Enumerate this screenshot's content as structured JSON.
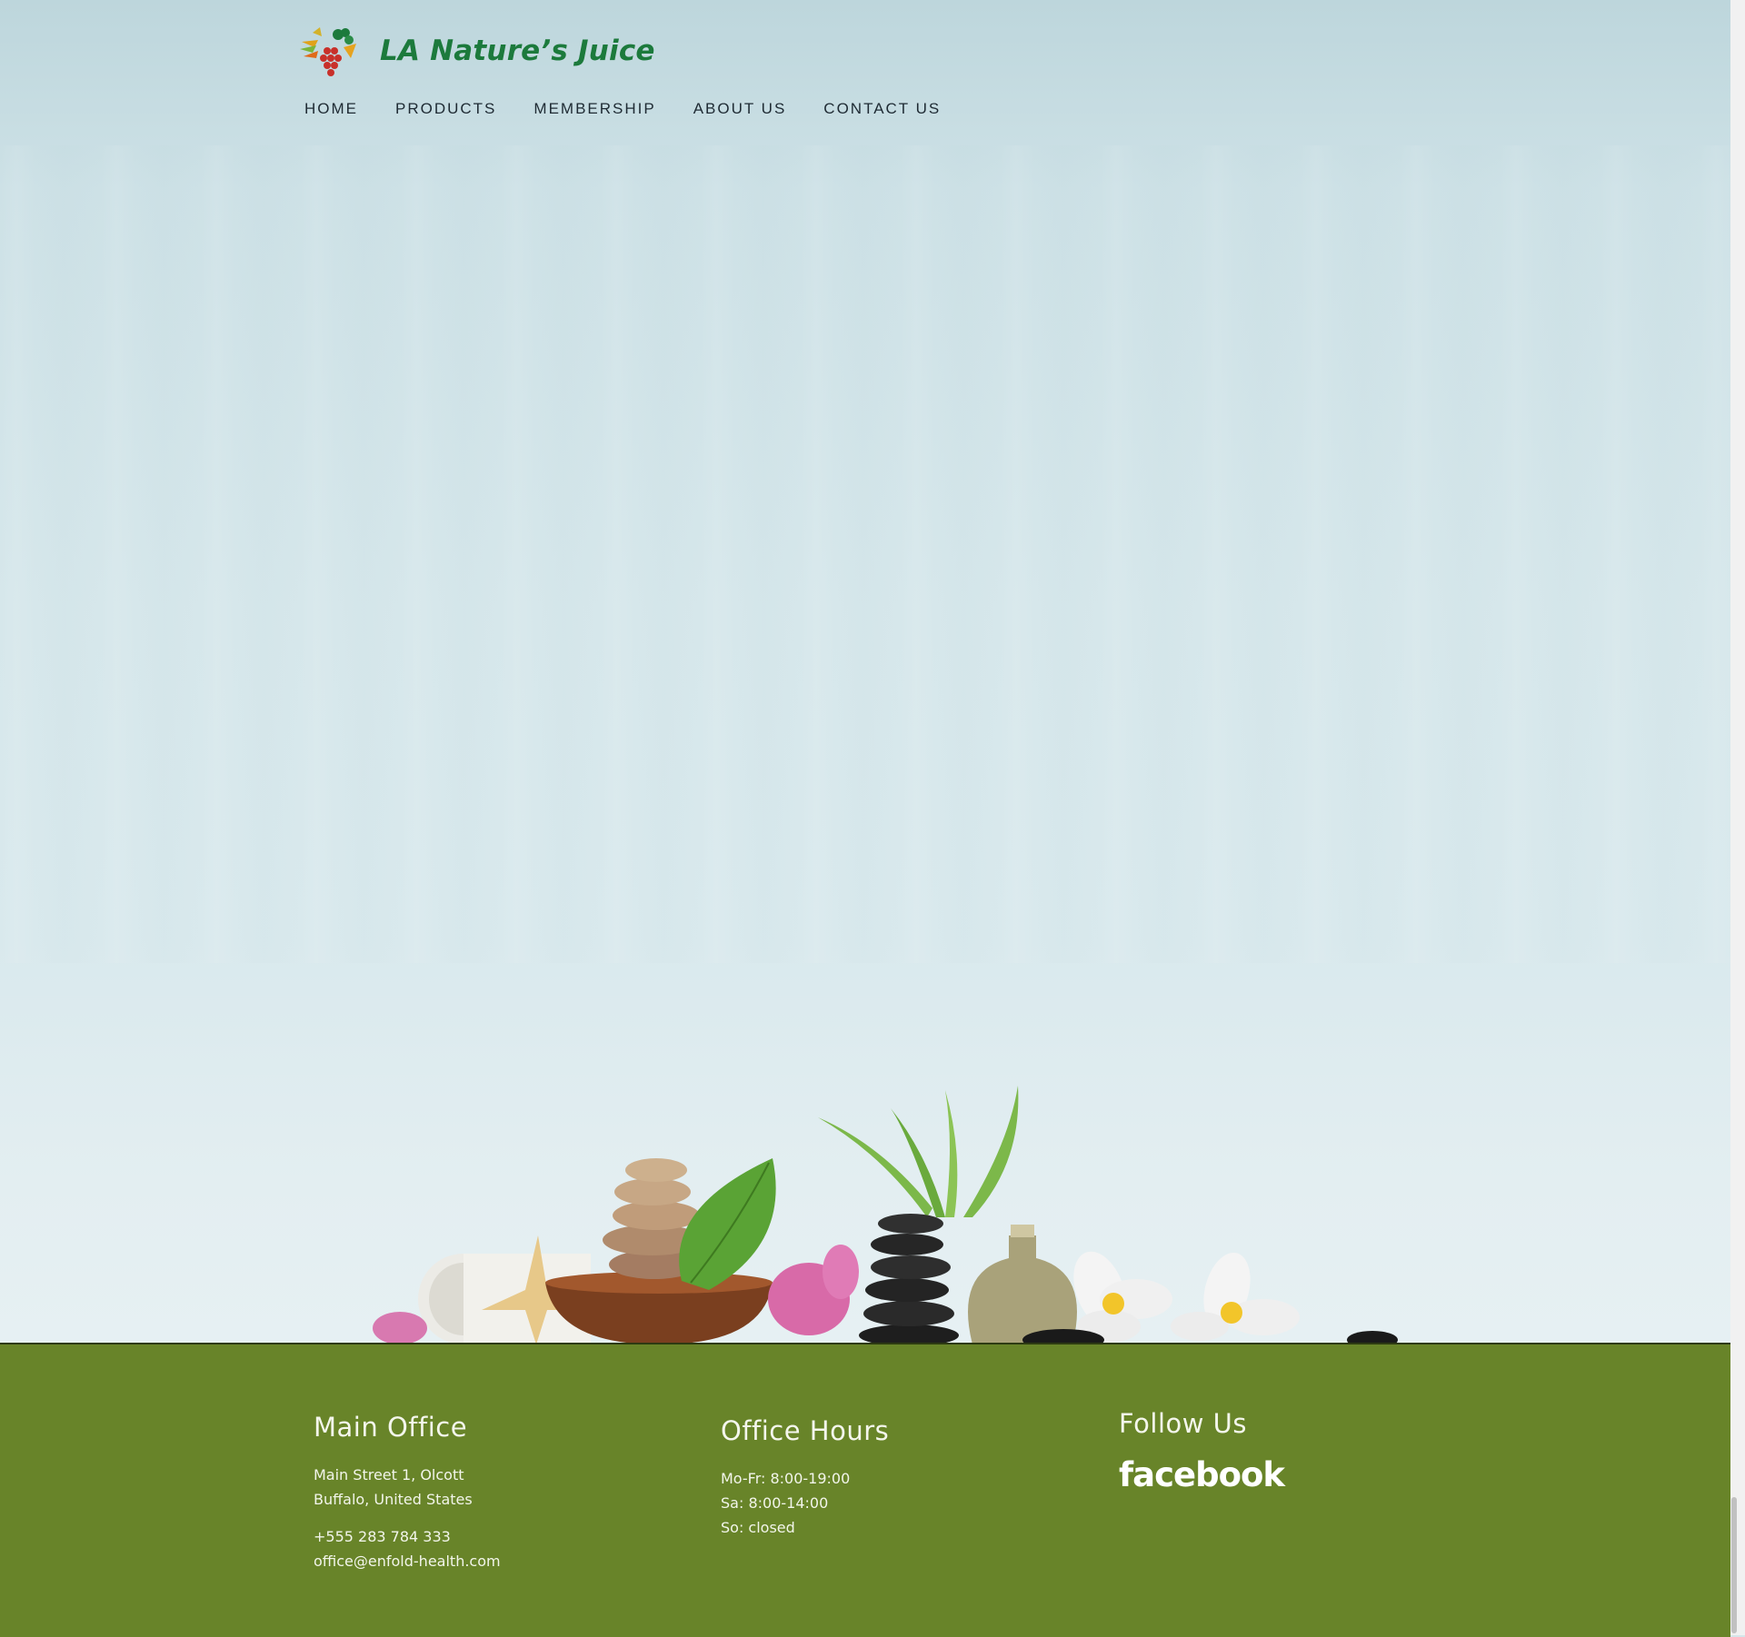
{
  "brand": {
    "name": "LA Nature’s Juice"
  },
  "nav": {
    "items": [
      {
        "label": "HOME"
      },
      {
        "label": "PRODUCTS"
      },
      {
        "label": "MEMBERSHIP"
      },
      {
        "label": "ABOUT US"
      },
      {
        "label": "CONTACT US"
      }
    ]
  },
  "footer": {
    "main_office": {
      "title": "Main Office",
      "address_line1": "Main Street 1, Olcott",
      "address_line2": "Buffalo, United States",
      "phone": "+555 283 784 333",
      "email": "office@enfold-health.com"
    },
    "office_hours": {
      "title": "Office Hours",
      "line1": "Mo-Fr: 8:00-19:00",
      "line2": "Sa: 8:00-14:00",
      "line3": "So: closed"
    },
    "follow": {
      "title": "Follow Us",
      "facebook": "facebook"
    }
  },
  "colors": {
    "brand_green": "#1c7a3c",
    "footer_green": "#688429",
    "hero_sky": "#d6e7eb"
  },
  "icons": {
    "logo": "fruit-heart-logo-icon",
    "facebook": "facebook-wordmark-icon"
  }
}
